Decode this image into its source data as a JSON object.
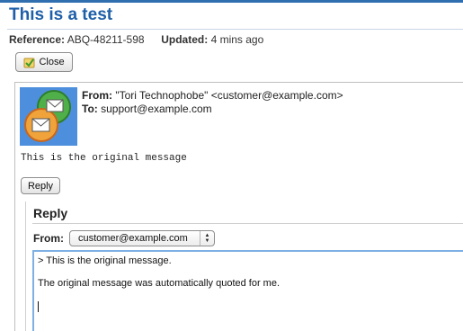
{
  "page": {
    "title": "This is a test",
    "reference_label": "Reference:",
    "reference_value": "ABQ-48211-598",
    "updated_label": "Updated:",
    "updated_value": "4 mins ago"
  },
  "toolbar": {
    "close_label": "Close",
    "close_icon": "close-icon"
  },
  "message": {
    "from_label": "From:",
    "from_value": "\"Tori Technophobe\" <customer@example.com>",
    "to_label": "To:",
    "to_value": "support@example.com",
    "body": "This is the original message",
    "avatar_icon": "mail-avatar-icon",
    "reply_button_label": "Reply"
  },
  "reply_form": {
    "heading": "Reply",
    "from_label": "From:",
    "from_selected": "customer@example.com",
    "textarea_line1": "> This is the original message.",
    "textarea_line2": "The original message was automatically quoted for me."
  },
  "colors": {
    "title": "#1f5fa8",
    "top_bar": "#2f6fb0",
    "textarea_focus": "#7fb0e3"
  }
}
